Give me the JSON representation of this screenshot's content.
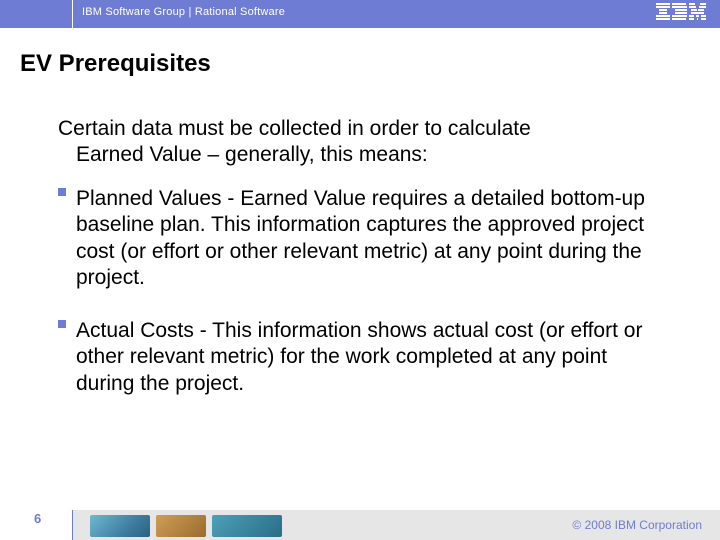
{
  "header": {
    "group_text": "IBM Software Group | Rational Software"
  },
  "title": "EV Prerequisites",
  "intro": {
    "line1": "Certain data must be collected in order to calculate",
    "line2": "Earned Value – generally, this means:"
  },
  "bullets": [
    "Planned Values - Earned Value requires a detailed bottom-up baseline plan. This information captures the approved project cost (or effort or other relevant metric) at any point during the project.",
    "Actual Costs - This information shows actual cost (or effort or other relevant metric) for the work completed at any point during the project."
  ],
  "footer": {
    "page_number": "6",
    "copyright": "© 2008 IBM Corporation"
  }
}
